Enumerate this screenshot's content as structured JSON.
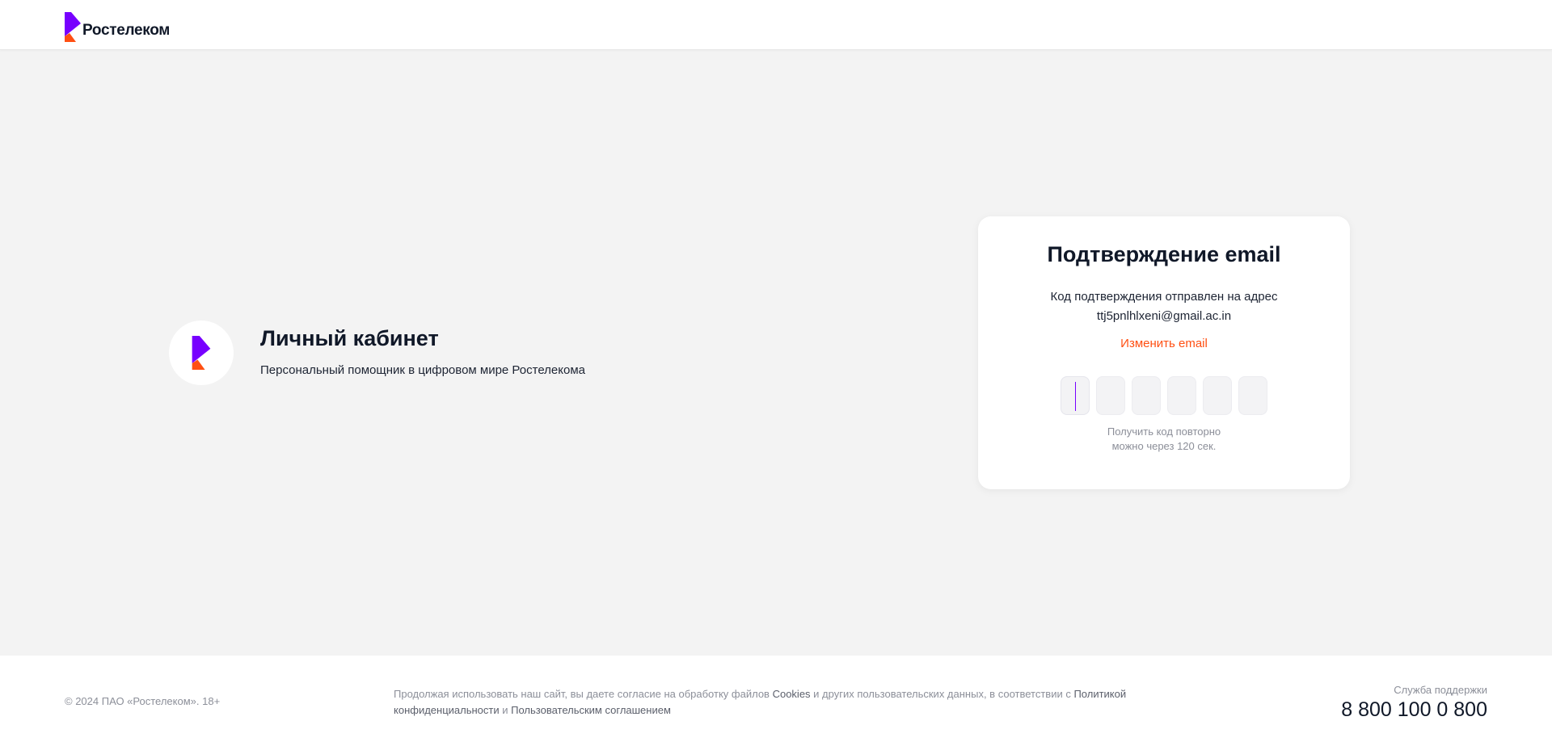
{
  "header": {
    "brand_name": "Ростелеком",
    "logo_icon": "rostelecom-logo-icon"
  },
  "hero": {
    "title": "Личный кабинет",
    "subtitle": "Персональный помощник в цифровом мире Ростелекома",
    "logo_icon": "rostelecom-logo-icon"
  },
  "confirmation": {
    "title": "Подтверждение email",
    "text_line1": "Код подтверждения отправлен на адрес",
    "email": "ttj5pnlhlxeni@gmail.ac.in",
    "change_email_label": "Изменить email",
    "code_digits": [
      "",
      "",
      "",
      "",
      "",
      ""
    ],
    "resend_line1": "Получить код повторно",
    "resend_line2": "можно через 120 сек."
  },
  "footer": {
    "copyright": "© 2024 ПАО «Ростелеком». 18+",
    "consent_part1": "Продолжая использовать наш сайт, вы даете согласие на обработку файлов ",
    "consent_cookies": "Cookies",
    "consent_part2": " и других пользовательских данных, в соответствии с ",
    "consent_privacy": "Политикой конфиденциальности",
    "consent_and": " и ",
    "consent_agreement": "Пользовательским соглашением",
    "support_label": "Служба поддержки",
    "support_phone": "8 800 100 0 800"
  },
  "colors": {
    "brand_purple": "#7700ff",
    "brand_orange": "#ff4f12",
    "background": "#f3f3f3"
  }
}
